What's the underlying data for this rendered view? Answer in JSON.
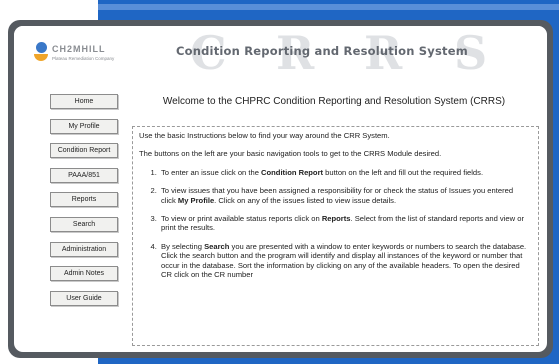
{
  "logo": {
    "name": "CH2MHILL",
    "subtitle": "Plateau Remediation Company"
  },
  "header": {
    "title": "Condition Reporting and Resolution System",
    "watermark": [
      "C",
      "R",
      "R",
      "S"
    ]
  },
  "nav": {
    "items": [
      {
        "label": "Home"
      },
      {
        "label": "My Profile"
      },
      {
        "label": "Condition Report"
      },
      {
        "label": "PAAA/851"
      },
      {
        "label": "Reports"
      },
      {
        "label": "Search"
      },
      {
        "label": "Administration"
      },
      {
        "label": "Admin Notes"
      },
      {
        "label": "User Guide"
      }
    ]
  },
  "main": {
    "welcome": "Welcome to the CHPRC Condition Reporting and Resolution System (CRRS)",
    "intro1": "Use the basic Instructions below to find your way around the CRR System.",
    "intro2": "The buttons on the left are your basic navigation tools to get to the CRRS Module desired.",
    "steps": [
      {
        "before": "To enter an issue click on the ",
        "bold": "Condition Report",
        "after": " button on the left and fill out the required fields."
      },
      {
        "before": "To view issues that you have been assigned a responsibility for or check the status of Issues you entered click  ",
        "bold": "My Profile",
        "after": ". Click on any of the issues listed to view issue details."
      },
      {
        "before": "To view or print available status reports click on ",
        "bold": "Reports",
        "after": ". Select from the list of standard reports and view or print the results."
      },
      {
        "before": "By selecting ",
        "bold": "Search",
        "after": " you are presented with a window to enter keywords or numbers to search the database. Click the search button and the program will identify and display all instances of the keyword or number that occur in the database. Sort the information by clicking on any of the available headers. To open the desired CR click on the CR number"
      }
    ]
  },
  "colors": {
    "background_blue": "#1f66c4",
    "frame": "#555a60",
    "title_text": "#636870",
    "watermark": "#dfe1e4"
  }
}
